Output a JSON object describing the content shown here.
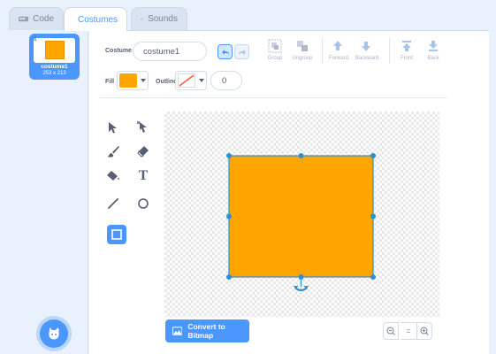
{
  "tabs": [
    {
      "label": "Code",
      "icon": "code-icon"
    },
    {
      "label": "Costumes",
      "icon": "paintbrush-icon"
    },
    {
      "label": "Sounds",
      "icon": "speaker-icon"
    }
  ],
  "costume_list": [
    {
      "number": "1",
      "name": "costume1",
      "size": "253 x 213",
      "selected": true,
      "thumbnail_color": "#ffa500"
    }
  ],
  "toolbar": {
    "costume_label": "Costume",
    "costume_name": "costume1",
    "undo_icon": "undo-icon",
    "redo_icon": "redo-icon",
    "group": "Group",
    "ungroup": "Ungroup",
    "forward": "Forward",
    "backward": "Backward",
    "front": "Front",
    "back": "Back",
    "fill_label": "Fill",
    "fill_color": "#ffa500",
    "outline_label": "Outline",
    "outline_width": "0"
  },
  "tools": [
    {
      "icon": "select-arrow-icon"
    },
    {
      "icon": "reshape-icon"
    },
    {
      "icon": "brush-icon"
    },
    {
      "icon": "eraser-icon"
    },
    {
      "icon": "fill-bucket-icon"
    },
    {
      "icon": "text-icon",
      "glyph": "T"
    },
    {
      "icon": "line-icon"
    },
    {
      "icon": "circle-icon"
    },
    {
      "icon": "rectangle-icon",
      "selected": true
    }
  ],
  "bottom": {
    "convert_label": "Convert to Bitmap",
    "zoom_out_icon": "zoom-out-icon",
    "zoom_reset_label": "=",
    "zoom_in_icon": "zoom-in-icon"
  },
  "colors": {
    "accent": "#4c97ff",
    "shape_fill": "#ffa500",
    "selection": "#2f8fd1"
  }
}
